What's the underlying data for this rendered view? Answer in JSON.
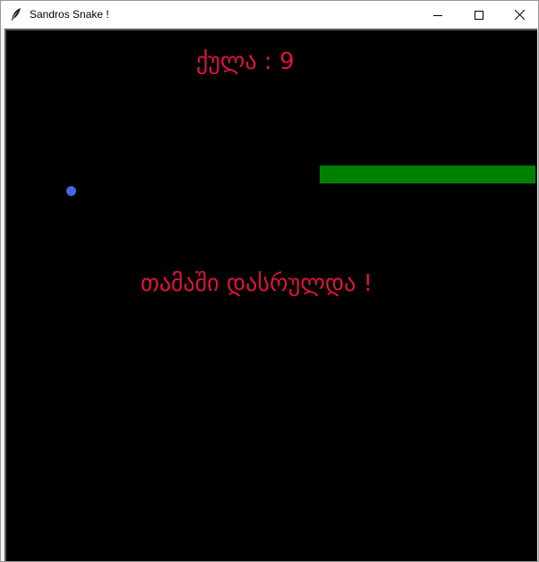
{
  "window": {
    "title": "Sandros Snake !",
    "app_icon": "feather-icon",
    "controls": [
      "minimize-icon",
      "maximize-icon",
      "close-icon"
    ]
  },
  "game": {
    "score_text": "ქულა : 9",
    "score_value": 9,
    "game_over_text": "თამაში დასრულდა !",
    "colors": {
      "background": "#000000",
      "text": "#dc143c",
      "snake": "#008000",
      "food": "#4169e1"
    }
  }
}
